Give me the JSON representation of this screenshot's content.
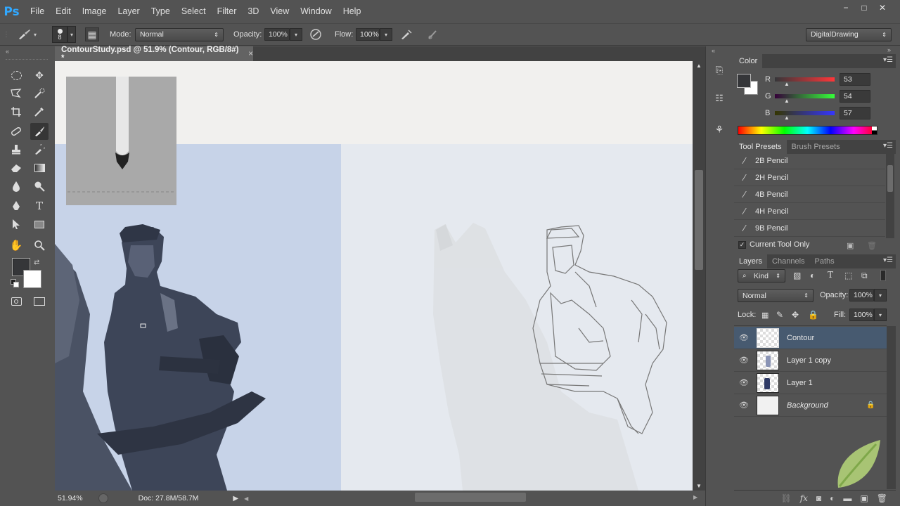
{
  "app": {
    "logo": "Ps"
  },
  "menu": [
    "File",
    "Edit",
    "Image",
    "Layer",
    "Type",
    "Select",
    "Filter",
    "3D",
    "View",
    "Window",
    "Help"
  ],
  "window_controls": {
    "minimize": "−",
    "restore": "□",
    "close": "✕"
  },
  "options": {
    "brush_size": "8",
    "mode_label": "Mode:",
    "mode_value": "Normal",
    "opacity_label": "Opacity:",
    "opacity_value": "100%",
    "flow_label": "Flow:",
    "flow_value": "100%",
    "workspace": "DigitalDrawing"
  },
  "document": {
    "tab_title": "ContourStudy.psd @ 51.9% (Contour, RGB/8#) *",
    "close": "×"
  },
  "status": {
    "zoom": "51.94%",
    "doc_info": "Doc: 27.8M/58.7M"
  },
  "color_panel": {
    "tab": "Color",
    "r_label": "R",
    "r_value": "53",
    "g_label": "G",
    "g_value": "54",
    "b_label": "B",
    "b_value": "57",
    "foreground": "#353639",
    "background": "#ffffff"
  },
  "presets_panel": {
    "tab_active": "Tool Presets",
    "tab_other": "Brush Presets",
    "items": [
      "2B Pencil",
      "2H Pencil",
      "4B Pencil",
      "4H Pencil",
      "9B Pencil"
    ],
    "current_tool_only": "Current Tool Only"
  },
  "layers_panel": {
    "tabs": [
      "Layers",
      "Channels",
      "Paths"
    ],
    "kind": "Kind",
    "blend_mode": "Normal",
    "opacity_label": "Opacity:",
    "opacity_value": "100%",
    "lock_label": "Lock:",
    "fill_label": "Fill:",
    "fill_value": "100%",
    "layers": [
      {
        "name": "Contour",
        "selected": true
      },
      {
        "name": "Layer 1 copy",
        "selected": false
      },
      {
        "name": "Layer 1",
        "selected": false
      },
      {
        "name": "Background",
        "selected": false,
        "locked": true
      }
    ]
  },
  "colors": {
    "accent_selected": "#475a70",
    "ps_blue": "#31a8ff"
  }
}
